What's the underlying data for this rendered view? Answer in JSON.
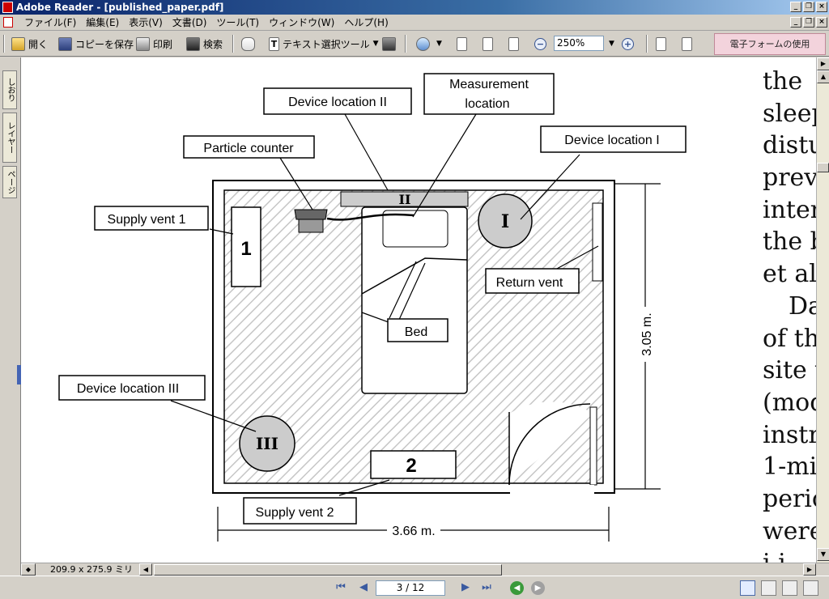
{
  "window": {
    "title": "Adobe Reader - [published_paper.pdf]"
  },
  "menu": [
    "ファイル(F)",
    "編集(E)",
    "表示(V)",
    "文書(D)",
    "ツール(T)",
    "ウィンドウ(W)",
    "ヘルプ(H)"
  ],
  "toolbar": {
    "open": "開く",
    "save_copy": "コピーを保存",
    "print": "印刷",
    "search": "検索",
    "text_select": "テキスト選択ツール",
    "zoom": "250%",
    "forms": "電子フォームの使用"
  },
  "nav_tabs": [
    "しおり",
    "レイヤー",
    "ページ"
  ],
  "document": {
    "text_lines": [
      "the",
      "sleep",
      "distu",
      "prev",
      "inter",
      "the b",
      "et al",
      "Da",
      "of th",
      "site w",
      "(mod",
      "instr",
      "1-mi",
      "perio",
      "were",
      "i  i  "
    ],
    "diagram": {
      "labels": {
        "device_loc_2": "Device location II",
        "measurement": "Measurement",
        "measurement_2": "location",
        "particle_counter": "Particle counter",
        "device_loc_1": "Device location  I",
        "supply_vent_1": "Supply vent 1",
        "return_vent": "Return vent",
        "bed": "Bed",
        "device_loc_3": "Device location  III",
        "supply_vent_2": "Supply vent 2"
      },
      "marks": {
        "vent1": "1",
        "vent2": "2",
        "loc1": "I",
        "loc2": "II",
        "loc3": "III"
      },
      "dimensions": {
        "height": "3.05 m.",
        "width": "3.66 m."
      }
    }
  },
  "statusbar": {
    "page_size": "209.9 x 275.9 ミリ",
    "page": "3 / 12"
  }
}
